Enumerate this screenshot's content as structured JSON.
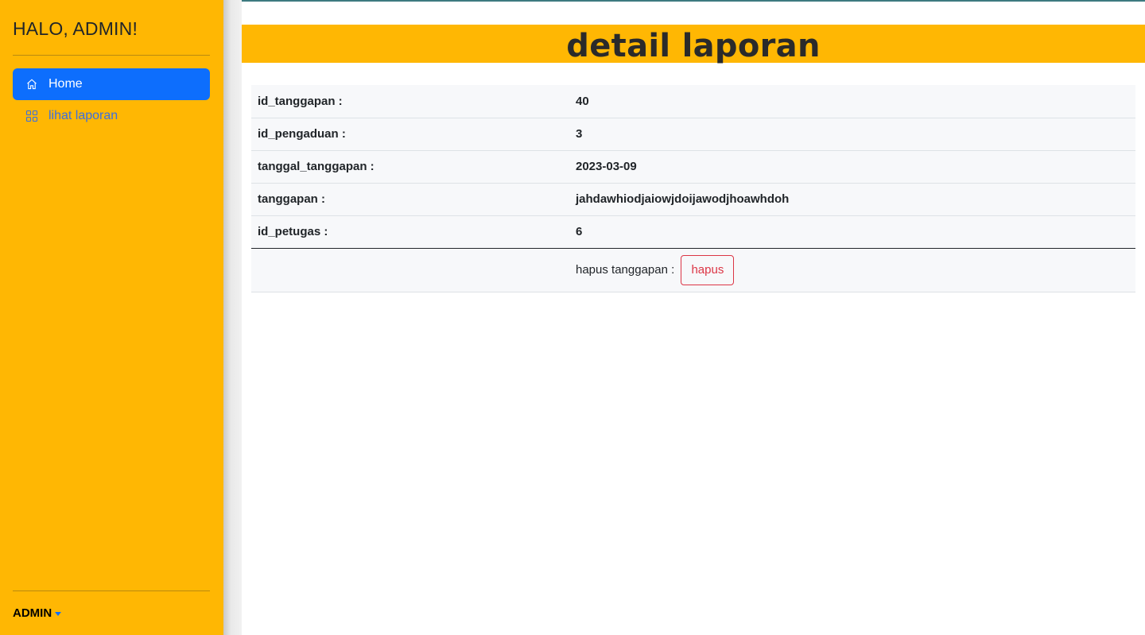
{
  "sidebar": {
    "greeting": "HALO, ADMIN!",
    "items": [
      {
        "label": "Home",
        "icon": "home-icon",
        "active": true
      },
      {
        "label": "lihat laporan",
        "icon": "grid-icon",
        "active": false
      }
    ],
    "user": "ADMIN"
  },
  "main": {
    "title": "detail laporan",
    "rows": [
      {
        "label": "id_tanggapan :",
        "value": "40"
      },
      {
        "label": "id_pengaduan :",
        "value": "3"
      },
      {
        "label": "tanggal_tanggapan :",
        "value": "2023-03-09"
      },
      {
        "label": "tanggapan :",
        "value": "jahdawhiodjaiowjdoijawodjhoawhdoh"
      },
      {
        "label": "id_petugas :",
        "value": "6"
      }
    ],
    "action": {
      "label": "hapus tanggapan :",
      "button": "hapus"
    }
  },
  "colors": {
    "accent": "#ffb703",
    "primary": "#0d6efd",
    "danger": "#dc3545"
  }
}
